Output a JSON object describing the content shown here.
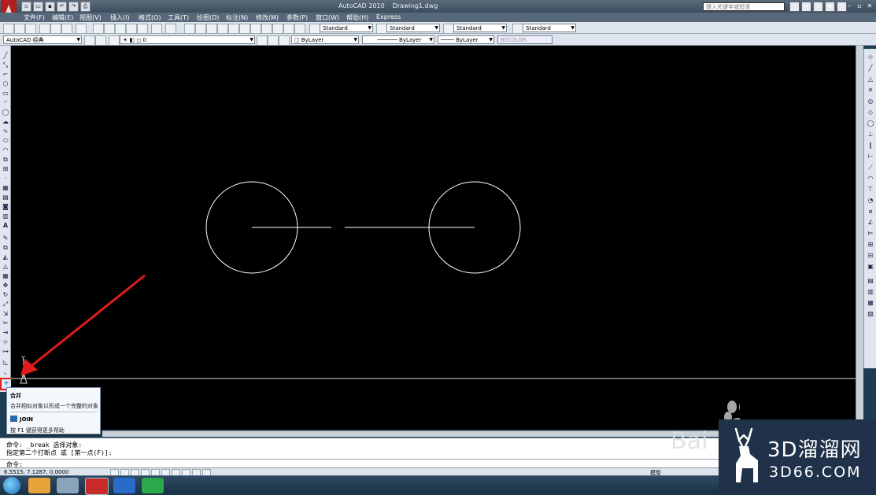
{
  "window": {
    "app_name": "AutoCAD 2010",
    "document": "Drawing1.dwg",
    "search_placeholder": "键入关键字或短语"
  },
  "menu": [
    "文件(F)",
    "编辑(E)",
    "视图(V)",
    "插入(I)",
    "格式(O)",
    "工具(T)",
    "绘图(D)",
    "标注(N)",
    "修改(M)",
    "参数(P)",
    "窗口(W)",
    "帮助(H)",
    "Express"
  ],
  "styles_toolbar": {
    "text_style": "Standard",
    "dim_style": "Standard",
    "table_style": "Standard",
    "mleader_style": "Standard"
  },
  "workspace_toolbar": {
    "workspace": "AutoCAD 经典",
    "layer": "0",
    "color": "ByLayer",
    "linetype": "ByLayer",
    "lineweight": "ByLayer",
    "plotstyle": "BYCOLOR"
  },
  "tooltip": {
    "title": "合并",
    "description": "合并相似对象以形成一个完整的对象",
    "command": "JOIN",
    "help": "按 F1 键获得更多帮助"
  },
  "command_line": {
    "line1": "命令: _break 选择对象:",
    "line2": "指定第二个打断点 或 [第一点(F)]:",
    "prompt": "命令:"
  },
  "status": {
    "coords": "6.5515, 7.1287, 0.0000",
    "model_label": "模型"
  },
  "watermark": {
    "brand": "3D溜溜网",
    "site": "3D66.COM",
    "baidu": "Bai"
  },
  "colors": {
    "canvas_bg": "#000000",
    "drawing_lines": "#ffffff",
    "annotation_arrow": "#e21b1b"
  }
}
